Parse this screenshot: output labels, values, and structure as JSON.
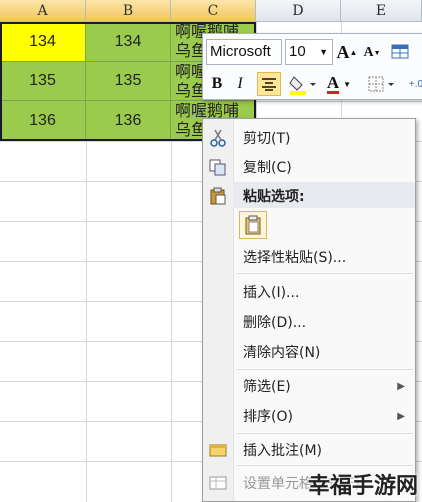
{
  "columns": [
    "A",
    "B",
    "C",
    "D",
    "E"
  ],
  "rows": [
    {
      "a": "134",
      "b": "134",
      "c": [
        "啊喔鹅哺",
        "乌鱼"
      ]
    },
    {
      "a": "135",
      "b": "135",
      "c": [
        "啊喔",
        "乌鱼"
      ]
    },
    {
      "a": "136",
      "b": "136",
      "c": [
        "啊喔鹅哺",
        "乌鱼"
      ]
    }
  ],
  "mini_toolbar": {
    "font_name": "Microsoft",
    "font_size": "10",
    "bold": "B",
    "italic": "I",
    "grow_font": "A",
    "shrink_font": "A",
    "font_color_letter": "A"
  },
  "context_menu": {
    "cut": "剪切(T)",
    "copy": "复制(C)",
    "paste_options": "粘贴选项:",
    "paste_special": "选择性粘贴(S)...",
    "insert": "插入(I)...",
    "delete": "删除(D)...",
    "clear_contents": "清除内容(N)",
    "filter": "筛选(E)",
    "sort": "排序(O)",
    "insert_comment": "插入批注(M)",
    "format_cells": "设置单元格格式(F)..."
  },
  "watermark": "幸福手游网",
  "colors": {
    "yellow": "#ffff00",
    "green": "#9bcb4c",
    "selected_header": "#f2c45d",
    "highlight": "#ffe79a"
  }
}
